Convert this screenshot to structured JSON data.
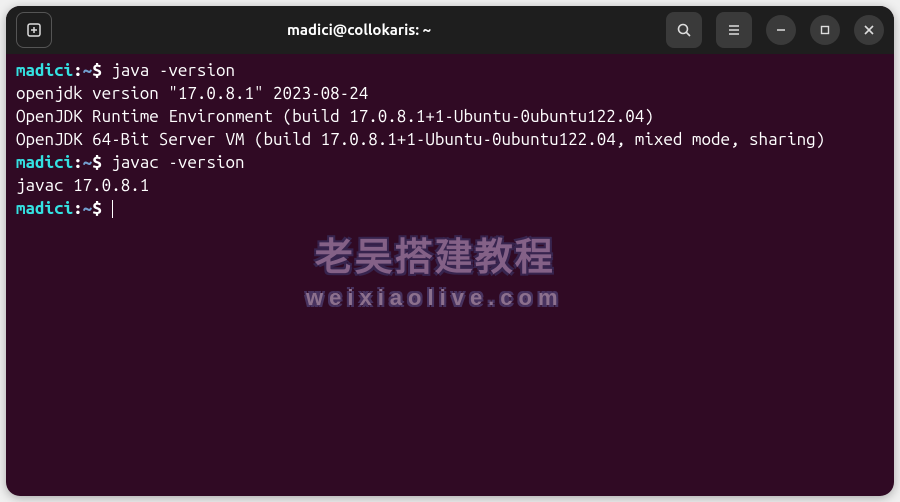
{
  "window": {
    "title": "madici@collokaris: ~"
  },
  "prompt": {
    "user": "madici",
    "sep": ":",
    "path": "~",
    "symbol": "$"
  },
  "commands": {
    "cmd1": "java -version",
    "cmd2": "javac -version"
  },
  "output": {
    "java1": "openjdk version \"17.0.8.1\" 2023-08-24",
    "java2": "OpenJDK Runtime Environment (build 17.0.8.1+1-Ubuntu-0ubuntu122.04)",
    "java3": "OpenJDK 64-Bit Server VM (build 17.0.8.1+1-Ubuntu-0ubuntu122.04, mixed mode, sharing)",
    "javac1": "javac 17.0.8.1"
  },
  "watermark": {
    "line1": "老吴搭建教程",
    "line2": "weixiaolive.com"
  }
}
